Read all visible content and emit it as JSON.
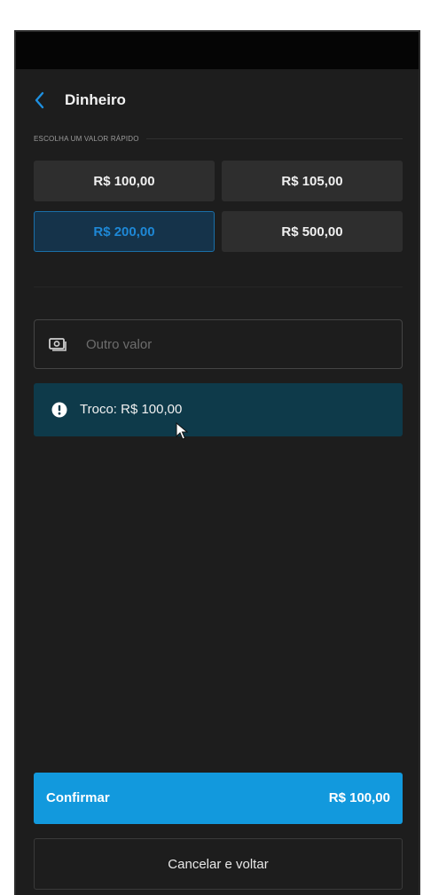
{
  "header": {
    "back_icon": "chevron-left-icon",
    "title": "Dinheiro"
  },
  "quick_values": {
    "label": "ESCOLHA UM VALOR RÁPIDO",
    "options": [
      {
        "label": "R$ 100,00",
        "selected": false
      },
      {
        "label": "R$ 105,00",
        "selected": false
      },
      {
        "label": "R$ 200,00",
        "selected": true
      },
      {
        "label": "R$ 500,00",
        "selected": false
      }
    ]
  },
  "other_value": {
    "icon": "money-icon",
    "placeholder": "Outro valor",
    "value": ""
  },
  "change": {
    "icon": "info-icon",
    "text": "Troco: R$ 100,00"
  },
  "actions": {
    "confirm_label": "Confirmar",
    "confirm_amount": "R$ 100,00",
    "cancel_label": "Cancelar e voltar"
  },
  "colors": {
    "accent": "#1299dd",
    "selected_text": "#1e88d6",
    "banner": "#0e3a4a",
    "background": "#1d1d1d"
  }
}
